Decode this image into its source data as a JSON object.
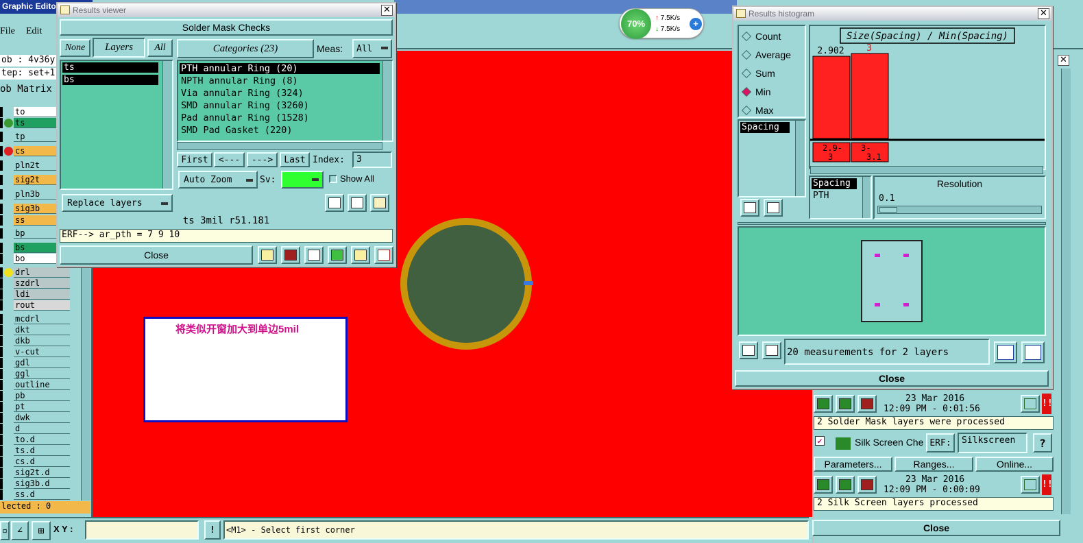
{
  "app": {
    "title": "Graphic Editor",
    "menu": [
      "File",
      "Edit"
    ],
    "job_line": "ob : 4v36y",
    "step_line": "tep: set+1",
    "matrix_label": "ob Matrix",
    "selected": "lected : 0"
  },
  "layers": [
    "to",
    "ts",
    "tp",
    "cs",
    "pln2t",
    "sig2t",
    "pln3b",
    "sig3b",
    "ss",
    "bp",
    "bs",
    "bo",
    "drl",
    "szdrl",
    "ldi",
    "rout",
    "mcdrl",
    "dkt",
    "dkb",
    "v-cut",
    "gdl",
    "ggl",
    "outline",
    "pb",
    "pt",
    "dwk",
    "d",
    "to.d",
    "ts.d",
    "cs.d",
    "sig2t.d",
    "sig3b.d",
    "ss.d"
  ],
  "status": {
    "xy_label": "X Y :",
    "xy_value": "",
    "hint": "<M1> - Select first corner"
  },
  "net": {
    "percent": "70%",
    "up": "7.5K/s",
    "down": "7.5K/s"
  },
  "annotation": {
    "text": "将类似开窗加大到单边5mil"
  },
  "results_viewer": {
    "title": "Results viewer",
    "header": "Solder Mask Checks",
    "none": "None",
    "layers": "Layers",
    "all": "All",
    "categories_btn": "Categories (23)",
    "meas_label": "Meas:",
    "meas_value": "All",
    "layer_list": [
      "ts",
      "bs"
    ],
    "categories": [
      "PTH annular Ring (20)",
      "NPTH annular Ring (8)",
      "Via annular Ring (324)",
      "SMD annular Ring (3260)",
      "Pad annular Ring (1528)",
      "SMD Pad Gasket (220)"
    ],
    "nav": {
      "first": "First",
      "prev": "<---",
      "next": "--->",
      "last": "Last",
      "index_label": "Index:",
      "index_value": "3"
    },
    "auto_zoom": "Auto Zoom",
    "sv_label": "Sv:",
    "show_all": "Show All",
    "replace_layers": "Replace layers",
    "status_line": "ts 3mil  r51.181",
    "erf_line": "ERF--> ar_pth = 7 9 10",
    "close": "Close"
  },
  "histogram": {
    "title": "Results histogram",
    "modes": [
      "Count",
      "Average",
      "Sum",
      "Min",
      "Max"
    ],
    "selected_mode": "Min",
    "chart_title": "Size(Spacing) / Min(Spacing)",
    "measure_list": [
      "Spacing"
    ],
    "sub_list": [
      "Spacing",
      "PTH"
    ],
    "resolution_label": "Resolution",
    "resolution_value": "0.1",
    "summary": "20 measurements for 2 layers",
    "close": "Close"
  },
  "chart_data": {
    "type": "bar",
    "categories": [
      "2.9-3",
      "3-3.1"
    ],
    "values": [
      2.902,
      3
    ],
    "data_labels": [
      "2.902",
      "3"
    ],
    "title": "Size(Spacing) / Min(Spacing)"
  },
  "checklist": {
    "row1_date": "23 Mar 2016",
    "row1_time": "12:09 PM - 0:01:56",
    "row1_msg": "2 Solder Mask layers were processed",
    "silk_label": "Silk Screen Che",
    "erf_label": "ERF:",
    "erf_value": "Silkscreen",
    "parameters": "Parameters...",
    "ranges": "Ranges...",
    "online": "Online...",
    "row2_date": "23 Mar 2016",
    "row2_time": "12:09 PM - 0:00:09",
    "row2_msg": "2 Silk Screen layers processed",
    "close": "Close"
  },
  "colors": {
    "canvas": "#ff0000",
    "pad_ring": "#c8960a",
    "pad_fill": "#406040",
    "bar": "#ff2020",
    "panel": "#9fd6d6",
    "list": "#5ac9a6"
  }
}
